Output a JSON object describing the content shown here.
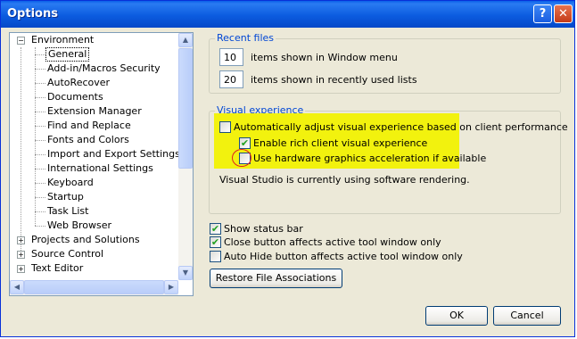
{
  "window": {
    "title": "Options",
    "help_glyph": "?",
    "close_glyph": "✕"
  },
  "tree": {
    "environment": "Environment",
    "children": [
      "General",
      "Add-in/Macros Security",
      "AutoRecover",
      "Documents",
      "Extension Manager",
      "Find and Replace",
      "Fonts and Colors",
      "Import and Export Settings",
      "International Settings",
      "Keyboard",
      "Startup",
      "Task List",
      "Web Browser"
    ],
    "projects": "Projects and Solutions",
    "source_control": "Source Control",
    "text_editor": "Text Editor",
    "selected": "General"
  },
  "recent_files": {
    "title": "Recent files",
    "window_menu_value": "10",
    "window_menu_label": "items shown in Window menu",
    "recent_lists_value": "20",
    "recent_lists_label": "items shown in recently used lists"
  },
  "visual_experience": {
    "title": "Visual experience",
    "auto_adjust_label": "Automatically adjust visual experience based on client performance",
    "auto_adjust_checked": false,
    "rich_client_label": "Enable rich client visual experience",
    "rich_client_checked": true,
    "hw_accel_label": "Use hardware graphics acceleration if available",
    "hw_accel_checked": false,
    "status_text": "Visual Studio is currently using software rendering."
  },
  "options": {
    "status_bar_label": "Show status bar",
    "close_button_label": "Close button affects active tool window only",
    "autohide_label": "Auto Hide button affects active tool window only",
    "restore_button": "Restore File Associations"
  },
  "footer": {
    "ok": "OK",
    "cancel": "Cancel"
  },
  "colors": {
    "title_bar": "#0a5fe8",
    "group_title": "#0046d5",
    "highlight": "#f2f20e",
    "check": "#21a121"
  }
}
